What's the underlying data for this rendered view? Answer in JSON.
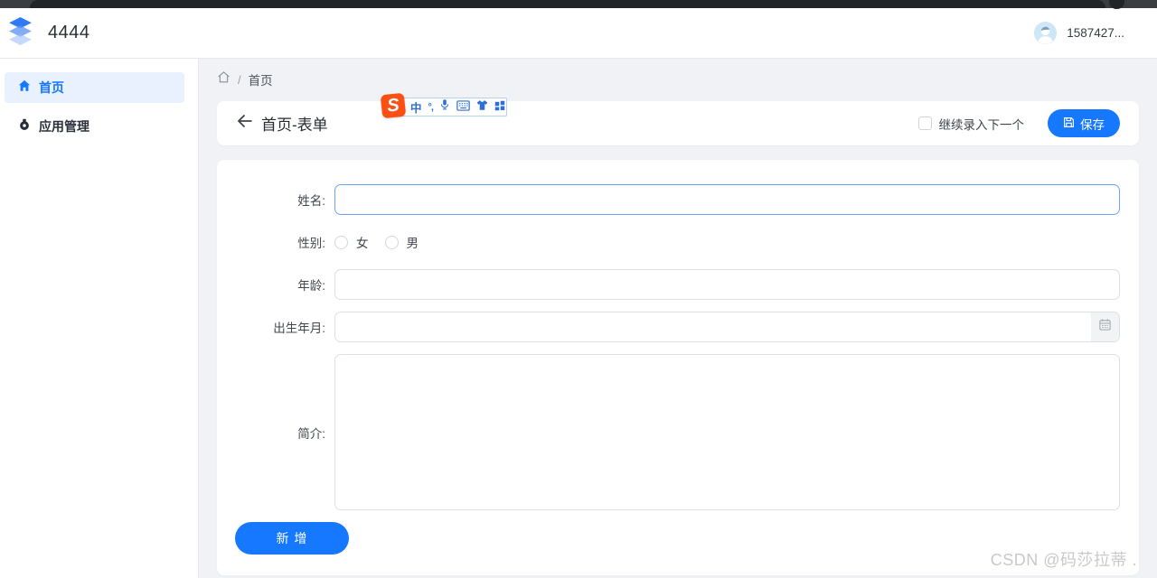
{
  "header": {
    "title": "4444",
    "username": "1587427..."
  },
  "sidebar": {
    "items": [
      {
        "label": "首页",
        "active": true
      },
      {
        "label": "应用管理",
        "active": false
      }
    ]
  },
  "breadcrumb": {
    "separator": "/",
    "current": "首页"
  },
  "ime_toolbar": {
    "logo": "S",
    "mode_label": "中",
    "punctuation_label": "°,"
  },
  "form_card": {
    "title": "首页-表单",
    "continue_checkbox_label": "继续录入下一个",
    "checkbox_checked": false,
    "save_button_label": "保存"
  },
  "form": {
    "fields": [
      {
        "label": "姓名:",
        "type": "text",
        "value": "",
        "state": "focused"
      },
      {
        "label": "性别:",
        "type": "radio-group",
        "options": [
          {
            "label": "女",
            "checked": false
          },
          {
            "label": "男",
            "checked": false
          }
        ]
      },
      {
        "label": "年龄:",
        "type": "text",
        "value": ""
      },
      {
        "label": "出生年月:",
        "type": "date",
        "value": ""
      },
      {
        "label": "简介:",
        "type": "textarea",
        "value": ""
      }
    ],
    "submit_button_label": "新 增"
  },
  "watermark": {
    "text": "CSDN @码莎拉蒂 ."
  },
  "colors": {
    "primary_blue": "#1677ff",
    "sidebar_active_bg": "#e8f1fd",
    "sidebar_active_text": "#1677ff",
    "content_bg": "#f0f2f5",
    "focused_input_border": "#6ca4f5",
    "ime_logo_orange": "#fb4f14",
    "ime_icon_blue": "#2d6fd3",
    "topbar_dark": "#232428"
  }
}
